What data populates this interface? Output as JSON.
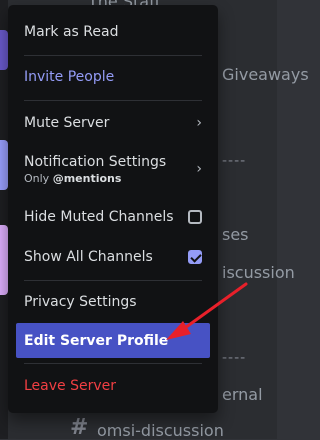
{
  "background": {
    "channels": [
      "Giveaways",
      "ses",
      "iscussion",
      "ernal",
      "omsi-discussion"
    ],
    "top_partial": "The Staff"
  },
  "menu": {
    "mark_as_read": "Mark as Read",
    "invite_people": "Invite People",
    "mute_server": "Mute Server",
    "notification_settings": "Notification Settings",
    "notification_sub_prefix": "Only",
    "notification_sub_value": "@mentions",
    "hide_muted_channels": "Hide Muted Channels",
    "show_all_channels": "Show All Channels",
    "privacy_settings": "Privacy Settings",
    "edit_server_profile": "Edit Server Profile",
    "leave_server": "Leave Server"
  },
  "state": {
    "hide_muted_checked": false,
    "show_all_checked": true
  },
  "colors": {
    "accent": "#4752c4",
    "invite": "#949cf7",
    "danger": "#f23f43",
    "arrow": "#e8202a"
  }
}
